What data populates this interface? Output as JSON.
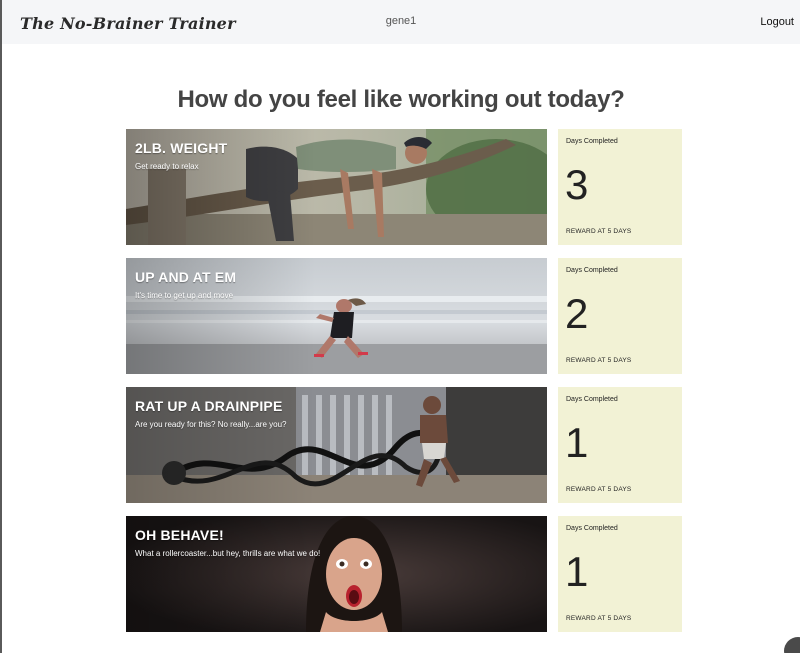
{
  "navbar": {
    "brand": "The No-Brainer Trainer",
    "username": "gene1",
    "logout_label": "Logout"
  },
  "main": {
    "heading": "How do you feel like working out today?"
  },
  "workouts": [
    {
      "title": "2LB. WEIGHT",
      "subtitle": "Get ready to relax",
      "days_label": "Days Completed",
      "days_completed": "3",
      "reward_label": "REWARD AT 5 DAYS"
    },
    {
      "title": "UP AND AT EM",
      "subtitle": "It's time to get up and move",
      "days_label": "Days Completed",
      "days_completed": "2",
      "reward_label": "REWARD AT 5 DAYS"
    },
    {
      "title": "RAT UP A DRAINPIPE",
      "subtitle": "Are you ready for this? No really...are you?",
      "days_label": "Days Completed",
      "days_completed": "1",
      "reward_label": "REWARD AT 5 DAYS"
    },
    {
      "title": "OH BEHAVE!",
      "subtitle": "What a rollercoaster...but hey, thrills are what we do!",
      "days_label": "Days Completed",
      "days_completed": "1",
      "reward_label": "REWARD AT 5 DAYS"
    }
  ],
  "colors": {
    "navbar_bg": "#f5f6f8",
    "stat_card_bg": "#f2f2d5",
    "heading_text": "#444444"
  }
}
